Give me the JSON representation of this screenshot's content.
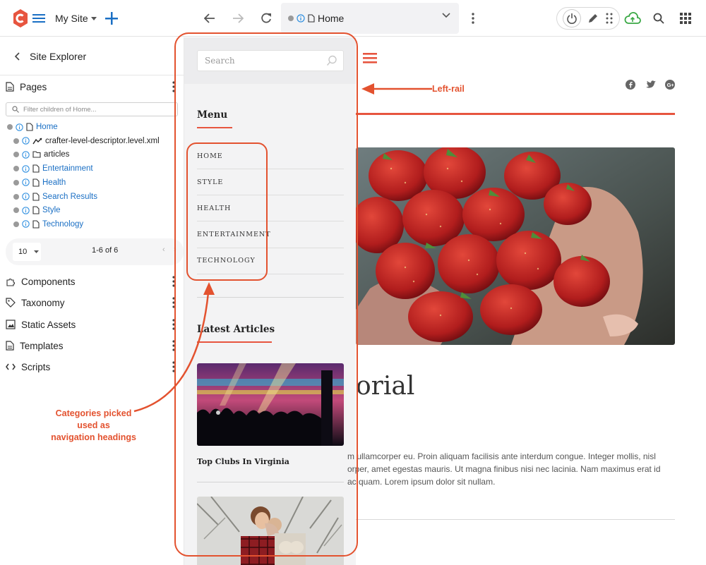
{
  "topbar": {
    "site_name": "My Site",
    "address_label": "Home"
  },
  "sidebar": {
    "title": "Site Explorer",
    "pages_label": "Pages",
    "filter_placeholder": "Filter children of Home...",
    "tree": [
      {
        "label": "Home",
        "kind": "page",
        "link": true
      },
      {
        "label": "crafter-level-descriptor.level.xml",
        "kind": "level-descriptor",
        "link": false
      },
      {
        "label": "articles",
        "kind": "folder",
        "link": false
      },
      {
        "label": "Entertainment",
        "kind": "page",
        "link": true
      },
      {
        "label": "Health",
        "kind": "page",
        "link": true
      },
      {
        "label": "Search Results",
        "kind": "page",
        "link": true
      },
      {
        "label": "Style",
        "kind": "page",
        "link": true
      },
      {
        "label": "Technology",
        "kind": "page",
        "link": true
      }
    ],
    "pager": {
      "page_size": "10",
      "range": "1-6 of 6"
    },
    "sections": [
      {
        "label": "Components",
        "icon": "puzzle-icon"
      },
      {
        "label": "Taxonomy",
        "icon": "tag-icon"
      },
      {
        "label": "Static Assets",
        "icon": "image-icon"
      },
      {
        "label": "Templates",
        "icon": "file-icon"
      },
      {
        "label": "Scripts",
        "icon": "code-icon"
      }
    ]
  },
  "rail": {
    "search_placeholder": "Search",
    "menu_heading": "Menu",
    "menu_items": [
      "HOME",
      "STYLE",
      "HEALTH",
      "ENTERTAINMENT",
      "TECHNOLOGY"
    ],
    "latest_heading": "Latest Articles",
    "article_title": "Top Clubs In Virginia"
  },
  "page": {
    "title_fragment": "orial",
    "body_lines": [
      "m ullamcorper eu. Proin aliquam facilisis ante interdum congue. Integer mollis, nisl",
      "orper, amet egestas mauris. Ut magna finibus nisi nec lacinia. Nam maximus erat id",
      "ac quam. Lorem ipsum dolor sit nullam."
    ]
  },
  "annotations": {
    "left_rail": "Left-rail",
    "categories": [
      "Categories picked",
      "used as",
      "navigation headings"
    ]
  },
  "colors": {
    "accent": "#e7553f",
    "annotation": "#e3522f",
    "link": "#1a6fc4",
    "publish_green": "#3aa845"
  }
}
